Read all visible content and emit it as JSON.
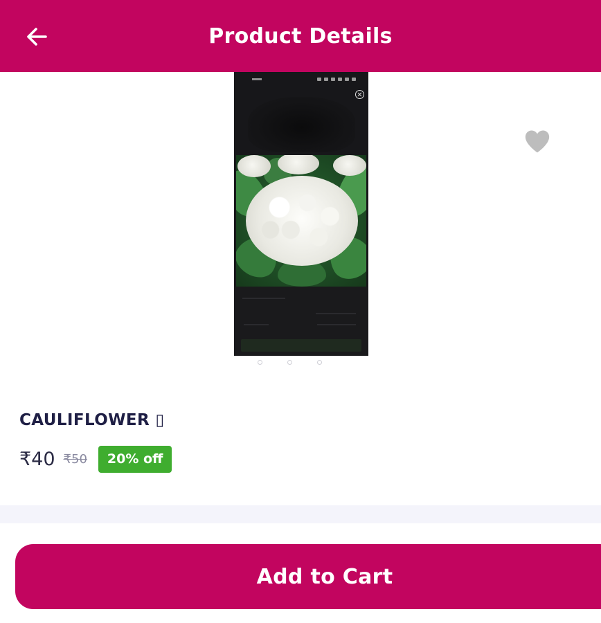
{
  "app_bar": {
    "title": "Product Details",
    "back_icon": "arrow-left-icon",
    "background_color": "#c2055f"
  },
  "product": {
    "name": "CAULIFLOWER ▯",
    "price": "₹40",
    "mrp": "₹50",
    "discount": "20% off",
    "discount_color": "#3fad2f",
    "favorite_icon": "heart-icon",
    "image_description_icons": [
      "close-icon"
    ],
    "image_count": 3
  },
  "footer": {
    "add_to_cart_label": "Add to Cart",
    "button_color": "#c2055f"
  }
}
